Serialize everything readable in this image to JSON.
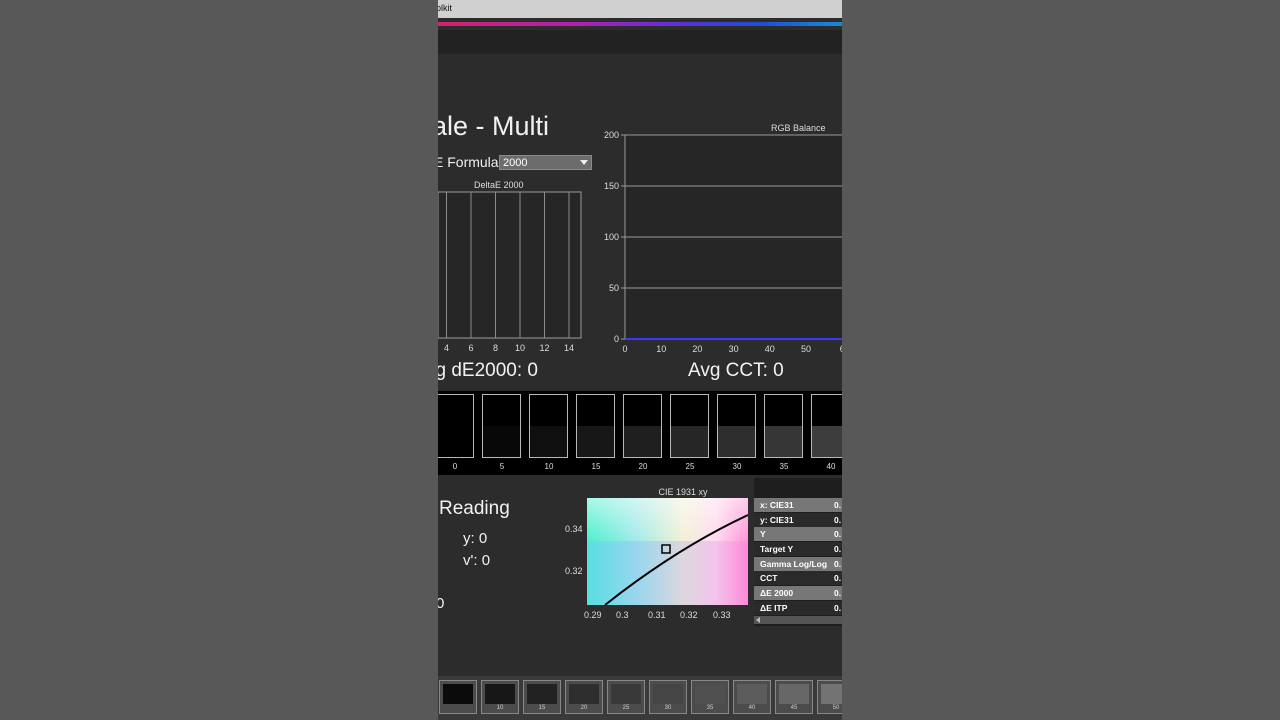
{
  "window": {
    "title_fragment": "olkit"
  },
  "page": {
    "title": "ale - Multi",
    "formula_label": "E Formula:",
    "formula_value": "2000",
    "avg_de": "vg dE2000: 0",
    "avg_cct": "Avg CCT: 0"
  },
  "colors": {
    "accent_start": "#d0246a",
    "accent_end": "#1a8ad8",
    "background": "#2c2c2c",
    "rgb_balance_line": "#3a3aff"
  },
  "chart_data": [
    {
      "type": "bar",
      "title": "DeltaE 2000",
      "xticks": [
        "4",
        "6",
        "8",
        "10",
        "12",
        "14"
      ],
      "values": []
    },
    {
      "type": "line",
      "title": "RGB Balance",
      "xticks": [
        "0",
        "10",
        "20",
        "30",
        "40",
        "50",
        "6"
      ],
      "yticks": [
        "200",
        "150",
        "100",
        "50",
        "0"
      ],
      "ylim": [
        0,
        200
      ],
      "series": [
        {
          "values": [
            0,
            0,
            0,
            0,
            0,
            0,
            0
          ]
        }
      ]
    },
    {
      "type": "scatter",
      "title": "CIE 1931 xy",
      "xticks": [
        "0.29",
        "0.3",
        "0.31",
        "0.32",
        "0.33"
      ],
      "yticks": [
        "0.34",
        "0.32"
      ]
    }
  ],
  "swatches": [
    {
      "label": "0",
      "level": 0
    },
    {
      "label": "5",
      "level": 5
    },
    {
      "label": "10",
      "level": 10
    },
    {
      "label": "15",
      "level": 15
    },
    {
      "label": "20",
      "level": 20
    },
    {
      "label": "25",
      "level": 25
    },
    {
      "label": "30",
      "level": 30
    },
    {
      "label": "35",
      "level": 35
    },
    {
      "label": "40",
      "level": 40
    }
  ],
  "reading": {
    "title": "Reading",
    "y": "y: 0",
    "v": "v': 0",
    "extra": "0"
  },
  "readings_table": [
    {
      "label": "x: CIE31",
      "value": "0."
    },
    {
      "label": "y: CIE31",
      "value": "0."
    },
    {
      "label": "Y",
      "value": "0."
    },
    {
      "label": "Target Y",
      "value": "0."
    },
    {
      "label": "Gamma Log/Log",
      "value": "0."
    },
    {
      "label": "CCT",
      "value": "0."
    },
    {
      "label": "ΔE 2000",
      "value": "0."
    },
    {
      "label": "ΔE ITP",
      "value": "0."
    }
  ],
  "patches": [
    {
      "label": "",
      "level": 5
    },
    {
      "label": "10",
      "level": 10
    },
    {
      "label": "15",
      "level": 15
    },
    {
      "label": "20",
      "level": 20
    },
    {
      "label": "25",
      "level": 25
    },
    {
      "label": "30",
      "level": 30
    },
    {
      "label": "35",
      "level": 35
    },
    {
      "label": "40",
      "level": 40
    },
    {
      "label": "45",
      "level": 45
    },
    {
      "label": "50",
      "level": 50
    },
    {
      "label": "55",
      "level": 55
    }
  ]
}
